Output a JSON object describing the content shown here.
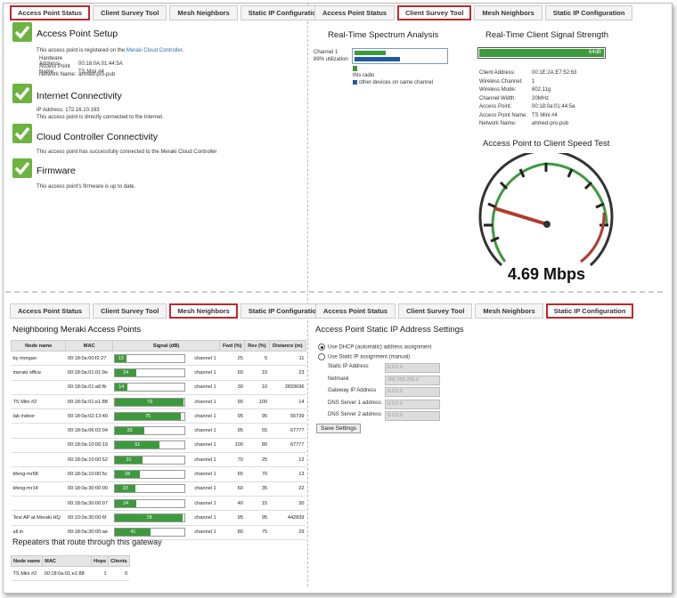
{
  "tabs": [
    "Access Point Status",
    "Client Survey Tool",
    "Mesh Neighbors",
    "Static IP Configuration"
  ],
  "status": {
    "sections": [
      {
        "title": "Access Point Setup",
        "lines": [
          {
            "pre": "This access point is registered on the ",
            "link": "Meraki Cloud Controller",
            "post": "."
          },
          {
            "label": "Hardware Address:",
            "value": "00:18:0A:01:44:5A"
          },
          {
            "label": "Access Point Name:",
            "value": "TS Mini #4"
          },
          {
            "label": "Network Name:",
            "value": "ahmed-pro-pub"
          }
        ]
      },
      {
        "title": "Internet Connectivity",
        "lines": [
          {
            "text": "IP Address: 172.16.10.193"
          },
          {
            "text": "This access point is directly connected to the Internet."
          }
        ]
      },
      {
        "title": "Cloud Controller Connectivity",
        "lines": [
          {
            "text": "This access point has successfully connected to the Meraki Cloud Controller"
          }
        ]
      },
      {
        "title": "Firmware",
        "lines": [
          {
            "text": "This access point's firmware is up to date."
          }
        ]
      }
    ]
  },
  "survey": {
    "spectrum_title": "Real-Time Spectrum Analysis",
    "channel_label": "Channel 1",
    "utilization_label": "89% utilization",
    "this_radio_pct": 33,
    "other_pct": 48,
    "legend_this": "this radio",
    "legend_other": "other devices on same channel",
    "signal_title": "Real-Time Client Signal Strength",
    "signal_value": "64dB",
    "client_info": [
      {
        "label": "Client Address:",
        "value": "00:1E:2A:E7:52:63"
      },
      {
        "label": "Wireless Channel:",
        "value": "1"
      },
      {
        "label": "Wireless Mode:",
        "value": "802.11g"
      },
      {
        "label": "Channel Width:",
        "value": "20MHz"
      },
      {
        "label": "Access Point:",
        "value": "00:18:0a:01:44:5a"
      },
      {
        "label": "Access Point Name:",
        "value": "TS Mini #4"
      },
      {
        "label": "Network Name:",
        "value": "ahmed-pro-pub"
      }
    ],
    "speed_title": "Access Point to Client Speed Test",
    "speed_value": "4.69 Mbps"
  },
  "mesh": {
    "title": "Neighboring Meraki Access Points",
    "headers": [
      "Node name",
      "MAC",
      "Signal (dB)",
      "",
      "Fwd (%)",
      "Rev (%)",
      "Distance (m)"
    ],
    "rows": [
      {
        "name": "by morgan",
        "mac": "00:18:0a:00:f2:27",
        "signal": "13",
        "channel": "channel 1",
        "fwd": "25",
        "rev": "5",
        "dist": "11"
      },
      {
        "name": "meraki office",
        "mac": "00:18:0a:01:01:9e",
        "signal": "24",
        "channel": "channel 1",
        "fwd": "60",
        "rev": "10",
        "dist": "23"
      },
      {
        "name": "",
        "mac": "00:18:0a:01:a6:fb",
        "signal": "14",
        "channel": "channel 1",
        "fwd": "30",
        "rev": "10",
        "dist": "2833696"
      },
      {
        "name": "TS Mini #2",
        "mac": "00:18:0a:01:e1:88",
        "signal": "79",
        "channel": "channel 1",
        "fwd": "90",
        "rev": "100",
        "dist": "14"
      },
      {
        "name": "lab indoor",
        "mac": "00:18:0a:02:13:40",
        "signal": "75",
        "channel": "channel 1",
        "fwd": "95",
        "rev": "95",
        "dist": "55739"
      },
      {
        "name": "",
        "mac": "00:18:0a:06:02:04",
        "signal": "33",
        "channel": "channel 1",
        "fwd": "95",
        "rev": "55",
        "dist": "67777"
      },
      {
        "name": "",
        "mac": "00:18:0a:10:00:19",
        "signal": "51",
        "channel": "channel 1",
        "fwd": "100",
        "rev": "80",
        "dist": "67777"
      },
      {
        "name": "",
        "mac": "00:18:0a:10:00:52",
        "signal": "31",
        "channel": "channel 1",
        "fwd": "70",
        "rev": "25",
        "dist": "12"
      },
      {
        "name": "kfeng-mr58",
        "mac": "00:18:0a:10:00:5c",
        "signal": "28",
        "channel": "channel 1",
        "fwd": "65",
        "rev": "70",
        "dist": "13"
      },
      {
        "name": "kfeng-mr14",
        "mac": "00:18:0a:30:00:00",
        "signal": "23",
        "channel": "channel 1",
        "fwd": "60",
        "rev": "35",
        "dist": "22"
      },
      {
        "name": "",
        "mac": "00:18:0a:30:00:07",
        "signal": "24",
        "channel": "channel 1",
        "fwd": "40",
        "rev": "15",
        "dist": "30"
      },
      {
        "name": "Test AP at Meraki HQ",
        "mac": "00:10:0a:30:00:6f",
        "signal": "78",
        "channel": "channel 1",
        "fwd": "95",
        "rev": "95",
        "dist": "442839"
      },
      {
        "name": "all in",
        "mac": "00:18:0a:30:00:ae",
        "signal": "41",
        "channel": "channel 1",
        "fwd": "80",
        "rev": "75",
        "dist": "29"
      }
    ],
    "repeaters_title": "Repeaters that route through this gateway",
    "rep_headers": [
      "Node name",
      "MAC",
      "Hops",
      "Clients"
    ],
    "rep_rows": [
      {
        "name": "TS Mini #2",
        "mac": "00:18:0a:01:e1:88",
        "hops": "1",
        "clients": "0"
      }
    ]
  },
  "staticip": {
    "title": "Access Point Static IP Address Settings",
    "opt_dhcp": "Use DHCP (automatic) address assignment",
    "opt_static": "Use Static IP assignment (manual)",
    "fields": [
      {
        "label": "Static IP Address",
        "value": "0.0.0.0"
      },
      {
        "label": "Netmask",
        "value": "255.255.255.0"
      },
      {
        "label": "Gateway IP Address",
        "value": "0.0.0.0"
      },
      {
        "label": "DNS Server 1 address",
        "value": "0.0.0.0"
      },
      {
        "label": "DNS Server 2 address",
        "value": "0.0.0.0"
      }
    ],
    "save_label": "Save Settings"
  }
}
